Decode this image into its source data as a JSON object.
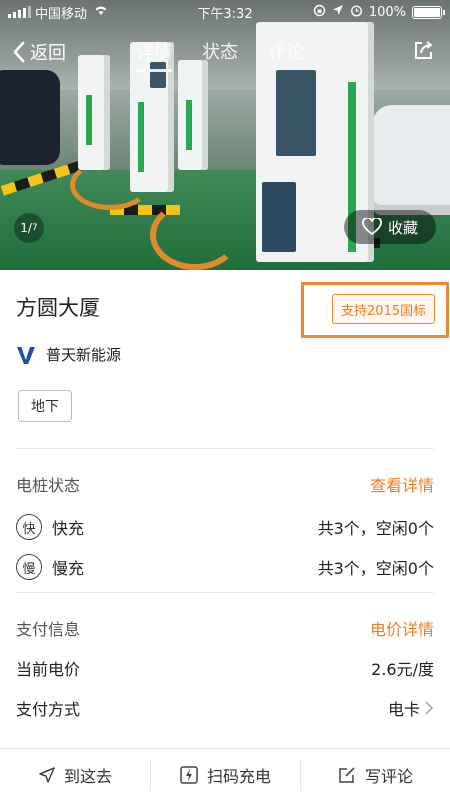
{
  "status_bar": {
    "carrier": "中国移动",
    "time": "下午3:32",
    "battery_text": "100%",
    "battery_level": 1.0
  },
  "nav": {
    "back_label": "返回",
    "tabs": [
      {
        "label": "详情",
        "active": true
      },
      {
        "label": "状态",
        "active": false
      },
      {
        "label": "评论",
        "active": false
      }
    ]
  },
  "gallery": {
    "pager_current": "1",
    "pager_total": "7",
    "favorite_label": "收藏"
  },
  "station": {
    "name": "方圆大厦",
    "standard_badge": "支持2015国标",
    "operator": "普天新能源",
    "operator_logo": "V",
    "location_tag": "地下"
  },
  "pile_status": {
    "title": "电桩状态",
    "link": "查看详情",
    "fast": {
      "icon": "快",
      "label": "快充",
      "value": "共3个，空闲0个"
    },
    "slow": {
      "icon": "慢",
      "label": "慢充",
      "value": "共3个，空闲0个"
    }
  },
  "payment": {
    "title": "支付信息",
    "link": "电价详情",
    "price_label": "当前电价",
    "price_value": "2.6元/度",
    "method_label": "支付方式",
    "method_value": "电卡"
  },
  "bottom_bar": {
    "navigate": "到这去",
    "scan": "扫码充电",
    "review": "写评论"
  },
  "colors": {
    "accent": "#f07d22",
    "highlight_box": "#f0872e",
    "operator_logo": "#1f4ea3"
  }
}
